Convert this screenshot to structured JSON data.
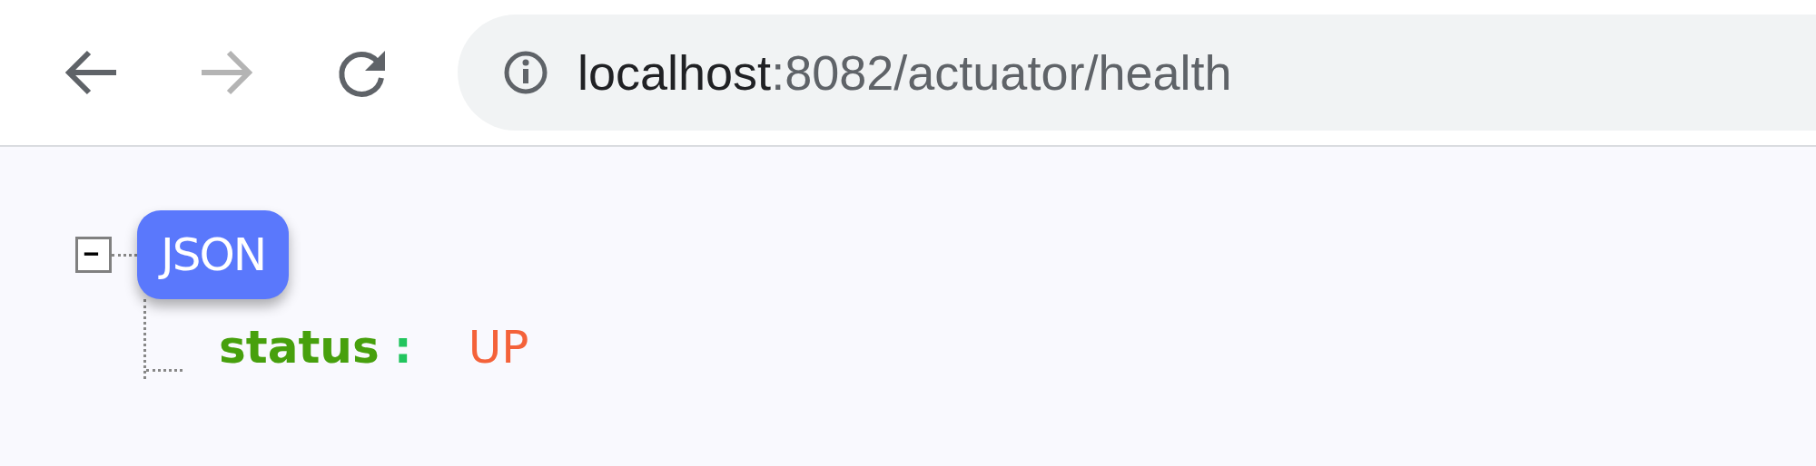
{
  "toolbar": {
    "back": {
      "disabled": false
    },
    "forward": {
      "disabled": true
    }
  },
  "address_bar": {
    "host": "localhost",
    "path": ":8082/actuator/health"
  },
  "json_tree": {
    "root_label": "JSON",
    "expanded": true,
    "entries": [
      {
        "key": "status",
        "separator": ":",
        "value": "UP"
      }
    ]
  }
}
